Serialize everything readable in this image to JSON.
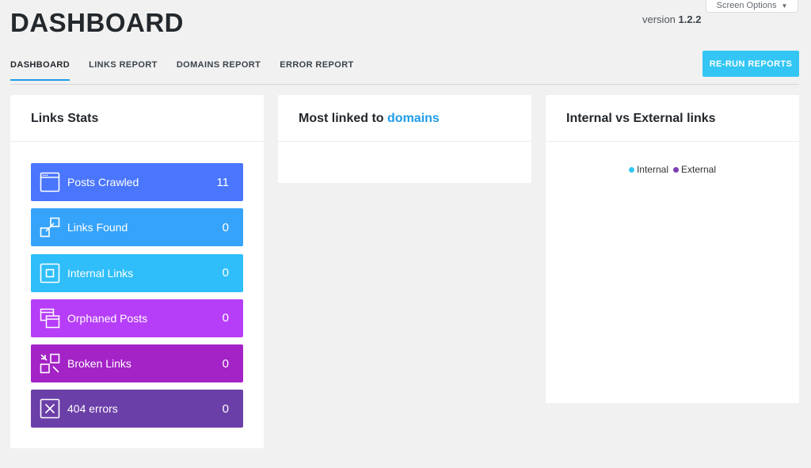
{
  "screen_options": {
    "label": "Screen Options"
  },
  "header": {
    "title": "DASHBOARD",
    "version_prefix": "version",
    "version_number": "1.2.2"
  },
  "tabs": [
    {
      "label": "DASHBOARD",
      "active": true
    },
    {
      "label": "LINKS REPORT",
      "active": false
    },
    {
      "label": "DOMAINS REPORT",
      "active": false
    },
    {
      "label": "ERROR REPORT",
      "active": false
    }
  ],
  "rerun_label": "RE-RUN REPORTS",
  "links_stats": {
    "title": "Links Stats",
    "items": [
      {
        "label": "Posts Crawled",
        "value": "11",
        "color": "#4a76fd",
        "icon": "browser-window-icon"
      },
      {
        "label": "Links Found",
        "value": "0",
        "color": "#36a3fb",
        "icon": "link-squares-icon"
      },
      {
        "label": "Internal Links",
        "value": "0",
        "color": "#2fbef9",
        "icon": "nested-square-icon"
      },
      {
        "label": "Orphaned Posts",
        "value": "0",
        "color": "#b73ef8",
        "icon": "stacked-windows-icon"
      },
      {
        "label": "Broken Links",
        "value": "0",
        "color": "#a323c6",
        "icon": "broken-link-icon"
      },
      {
        "label": "404 errors",
        "value": "0",
        "color": "#6b3fa8",
        "icon": "x-box-icon"
      }
    ]
  },
  "most_linked": {
    "title_prefix": "Most linked to",
    "title_link": "domains"
  },
  "internal_external": {
    "title": "Internal vs External links",
    "legend": [
      {
        "label": "Internal",
        "color": "#33c6f4"
      },
      {
        "label": "External",
        "color": "#7b3fb0"
      }
    ]
  }
}
